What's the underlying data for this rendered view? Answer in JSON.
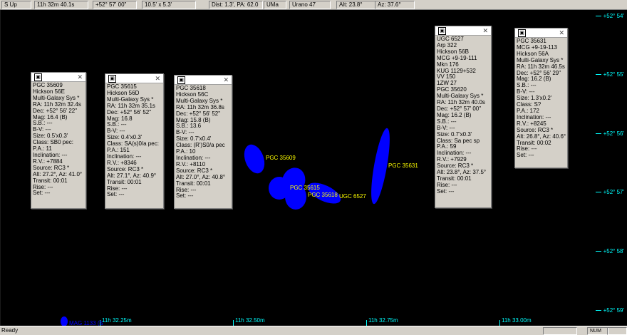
{
  "toolbar": [
    "S Up",
    "11h 32m 40.1s",
    "+52° 57' 00\"",
    "10.5' x 5.3'",
    "Dist: 1.3', PA: 62.0",
    "UMa",
    "Urano 47",
    "Alt: 23.8°",
    "Az: 37.6°"
  ],
  "dec_labels": [
    "+52° 54'",
    "+52° 55'",
    "+52° 56'",
    "+52° 57'",
    "+52° 58'",
    "+52° 59'"
  ],
  "ra_labels": [
    "11h 32.25m",
    "11h 32.50m",
    "11h 32.75m",
    "11h 33.00m"
  ],
  "galaxy_labels": {
    "g35609": "PGC 35609",
    "g35615": "PGC 35615",
    "g35618": "PGC 35618",
    "u6527": "UGC 6527",
    "g35631": "PGC 35631",
    "mag_partial": "MAG 1133 (S"
  },
  "popups": [
    {
      "lines": [
        "PGC 35609",
        "Hickson 56E",
        "Multi-Galaxy Sys   *",
        "RA: 11h 32m 32.4s",
        "Dec: +52° 56' 22\"",
        "Mag: 16.4 (B)",
        "S.B.: ---",
        "B-V: ---",
        "Size: 0.5'x0.3'",
        "Class: SB0 pec:",
        "P.A.: 11",
        "Inclination: ---",
        "R.V.: +7884",
        "Source: RC3 *",
        "Alt: 27.2°, Az: 41.0°",
        "Transit: 00:01",
        "Rise: ---",
        "Set: ---"
      ]
    },
    {
      "lines": [
        "PGC 35615",
        "Hickson 56D",
        "Multi-Galaxy Sys   *",
        "RA: 11h 32m 35.1s",
        "Dec: +52° 56' 52\"",
        "Mag: 16.8",
        "S.B.: ---",
        "B-V: ---",
        "Size: 0.4'x0.3'",
        "Class: SA(s)0/a pec:",
        "P.A.: 151",
        "Inclination: ---",
        "R.V.: +8346",
        "Source: RC3 *",
        "Alt: 27.1°, Az: 40.9°",
        "Transit: 00:01",
        "Rise: ---",
        "Set: ---"
      ]
    },
    {
      "lines": [
        "PGC 35618",
        "Hickson 56C",
        "Multi-Galaxy Sys   *",
        "RA: 11h 32m 36.8s",
        "Dec: +52° 56' 52\"",
        "Mag: 15.8 (B)",
        "S.B.: 13.6",
        "B-V: ---",
        "Size: 0.7'x0.4'",
        "Class: (R')S0/a pec",
        "P.A.: 10",
        "Inclination: ---",
        "R.V.: +8110",
        "Source: RC3 *",
        "Alt: 27.0°, Az: 40.8°",
        "Transit: 00:01",
        "Rise: ---",
        "Set: ---"
      ]
    },
    {
      "lines": [
        "UGC 6527",
        "Arp 322",
        "Hickson 56B",
        "MCG +9-19-111",
        "Mkn 176",
        "KUG 1129+532",
        "VV 150",
        "1ZW 27",
        "PGC 35620",
        "Multi-Galaxy Sys   *",
        "RA: 11h 32m 40.0s",
        "Dec: +52° 57' 00\"",
        "Mag: 16.2 (B)",
        "S.B.: ---",
        "B-V: ---",
        "Size: 0.7'x0.3'",
        "Class: Sa pec sp",
        "P.A.: 59",
        "Inclination: ---",
        "R.V.: +7929",
        "Source: RC3 *",
        "Alt: 23.8°, Az: 37.5°",
        "Transit: 00:01",
        "Rise: ---",
        "Set: ---"
      ]
    },
    {
      "lines": [
        "PGC 35631",
        "MCG +9-19-113",
        "Hickson 56A",
        "Multi-Galaxy Sys   *",
        "RA: 11h 32m 46.5s",
        "Dec: +52° 56' 29\"",
        "Mag: 16.2 (B)",
        "S.B.: ---",
        "B-V: ---",
        "Size: 1.3'x0.2'",
        "Class: S?",
        "P.A.: 172",
        "Inclination: ---",
        "R.V.: +8245",
        "Source: RC3 *",
        "Alt: 26.8°, Az: 40.6°",
        "Transit: 00:02",
        "Rise: ---",
        "Set: ---"
      ]
    }
  ],
  "status": {
    "text": "Ready",
    "num": "NUM"
  },
  "colors": {
    "sky": "#000000",
    "galaxy": "#0000ff",
    "label": "#ffff00",
    "grid": "#00ffff",
    "chrome": "#d4d0c8"
  }
}
